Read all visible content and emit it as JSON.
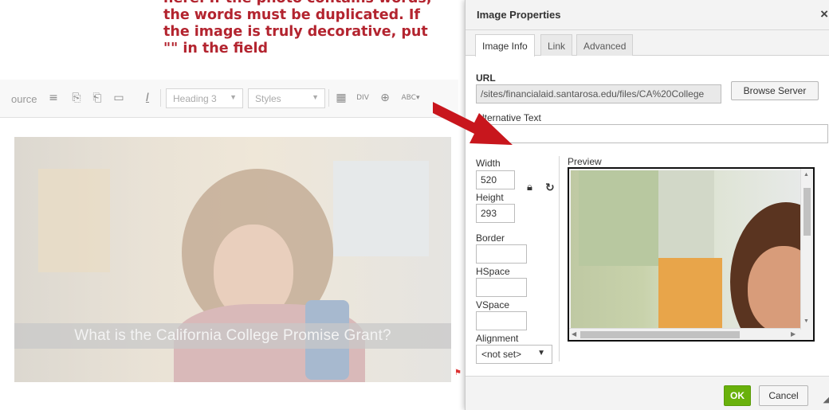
{
  "annotation": {
    "lines": [
      "here. If the photo contains words,",
      "the words must be duplicated. If",
      "the image is truly decorative, put",
      "\"\" in the field"
    ],
    "color": "#b3242f"
  },
  "toolbar": {
    "source_label": "ource",
    "format_combo": "Heading 3",
    "styles_combo": "Styles",
    "icons": [
      "justify-icon",
      "paste-icon",
      "paste-text-icon",
      "paste-word-icon",
      "remove-format-icon",
      "table-icon",
      "div-icon",
      "link-icon",
      "spellcheck-icon"
    ],
    "spellcheck_label": "ABC"
  },
  "editor": {
    "caption": "What is the California College Promise Grant?"
  },
  "dialog": {
    "title": "Image Properties",
    "close_glyph": "×",
    "tabs": [
      {
        "label": "Image Info",
        "active": true
      },
      {
        "label": "Link",
        "active": false
      },
      {
        "label": "Advanced",
        "active": false
      }
    ],
    "url_label": "URL",
    "url_value": "/sites/financialaid.santarosa.edu/files/CA%20College",
    "browse_label": "Browse Server",
    "alt_label": "Alternative Text",
    "alt_value": "",
    "width_label": "Width",
    "width_value": "520",
    "height_label": "Height",
    "height_value": "293",
    "border_label": "Border",
    "border_value": "",
    "hspace_label": "HSpace",
    "hspace_value": "",
    "vspace_label": "VSpace",
    "vspace_value": "",
    "alignment_label": "Alignment",
    "alignment_value": "<not set>",
    "preview_label": "Preview",
    "ok_label": "OK",
    "cancel_label": "Cancel",
    "ok_color": "#69b10b"
  }
}
